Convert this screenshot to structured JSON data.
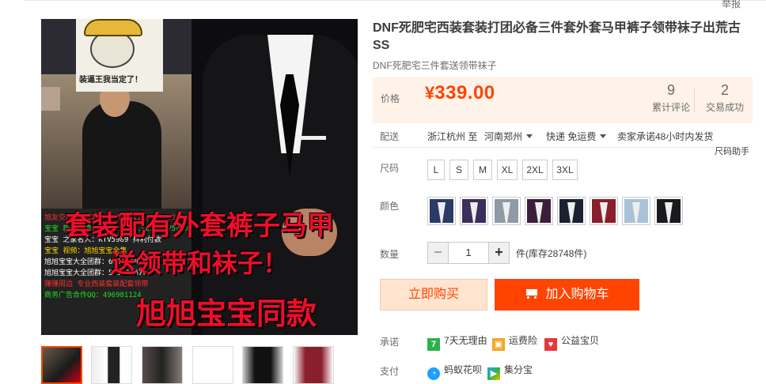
{
  "report_link": "举报",
  "gallery": {
    "meme_caption": "装逼王我当定了！",
    "overlay_line1": "套装配有外套裤子马甲",
    "overlay_line2": "送领带和袜子！",
    "overlay_line3": "旭旭宝宝同款",
    "scroll_lines": [
      {
        "text": "旭友交流群：327174012，1159306612",
        "color": "#ff3030"
      },
      {
        "text": "宝宝 新浪微博：www.weibo.com/KTV5989",
        "color": "#22dd22"
      },
      {
        "text": "宝宝 之家名人：KTV5989  抖利付数",
        "color": "#ffffff"
      },
      {
        "text": "宝宝 视频：旭旭宝宝全集",
        "color": "#ffd700"
      },
      {
        "text": "旭旭宝宝大全团群：600560989",
        "color": "#ffffff"
      },
      {
        "text": "旭旭宝宝大全团群：579796670",
        "color": "#ffffff"
      },
      {
        "text": "赚赚周边 专业西装套装配套领带",
        "color": "#ff3030"
      },
      {
        "text": "商务广告合作QQ：496981124",
        "color": "#22dd22"
      }
    ],
    "thumbnail_count": 6
  },
  "product": {
    "title": "DNF死肥宅西装套装打团必备三件套外套马甲裤子领带袜子出荒古SS",
    "subtitle": "DNF死肥宅三件套送领带袜子"
  },
  "price": {
    "label": "价格",
    "currency": "¥",
    "amount": "339.00",
    "reviews_count": "9",
    "reviews_label": "累计评论",
    "sales_count": "2",
    "sales_label": "交易成功",
    "accent_color": "#ff4400"
  },
  "shipping": {
    "label": "配送",
    "from": "浙江杭州 至",
    "to": "河南郑州",
    "method": "快递 免运费",
    "promise": "卖家承诺48小时内发货",
    "size_help": "尺码助手"
  },
  "sizes": {
    "label": "尺码",
    "options": [
      "L",
      "S",
      "M",
      "XL",
      "2XL",
      "3XL"
    ]
  },
  "colors": {
    "label": "颜色",
    "swatches": [
      "#2b3a66",
      "#3a2f5a",
      "#8e9aa5",
      "#3a1f3d",
      "#1c2033",
      "#8a1e2b",
      "#a8c3d8",
      "#1a1a1e"
    ]
  },
  "quantity": {
    "label": "数量",
    "value": "1",
    "stock": "件(库存28748件)"
  },
  "actions": {
    "buy_now": "立即购买",
    "add_to_cart": "加入购物车"
  },
  "promises": {
    "label": "承诺",
    "items": [
      "7天无理由",
      "运费险",
      "公益宝贝"
    ]
  },
  "payment": {
    "label": "支付",
    "items": [
      "蚂蚁花呗",
      "集分宝"
    ]
  }
}
